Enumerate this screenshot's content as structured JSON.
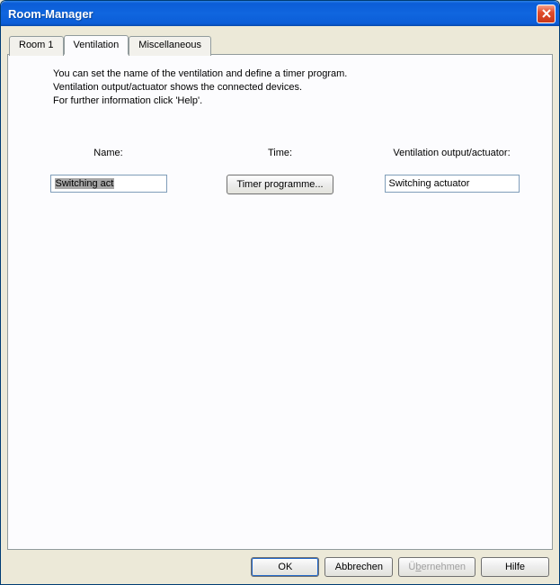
{
  "window": {
    "title": "Room-Manager"
  },
  "tabs": {
    "room1": "Room 1",
    "ventilation": "Ventilation",
    "misc": "Miscellaneous"
  },
  "description": {
    "line1": "You can set the name of the ventilation and define a timer program.",
    "line2": "Ventilation output/actuator shows the connected devices.",
    "line3": "For further information click 'Help'."
  },
  "columns": {
    "name_label": "Name:",
    "time_label": "Time:",
    "output_label": "Ventilation output/actuator:",
    "name_value": "Switching act",
    "timer_button": "Timer programme...",
    "output_value": "Switching actuator"
  },
  "footer": {
    "ok": "OK",
    "cancel": "Abbrechen",
    "apply_pre": "Ü",
    "apply_u": "b",
    "apply_post": "ernehmen",
    "help": "Hilfe"
  }
}
